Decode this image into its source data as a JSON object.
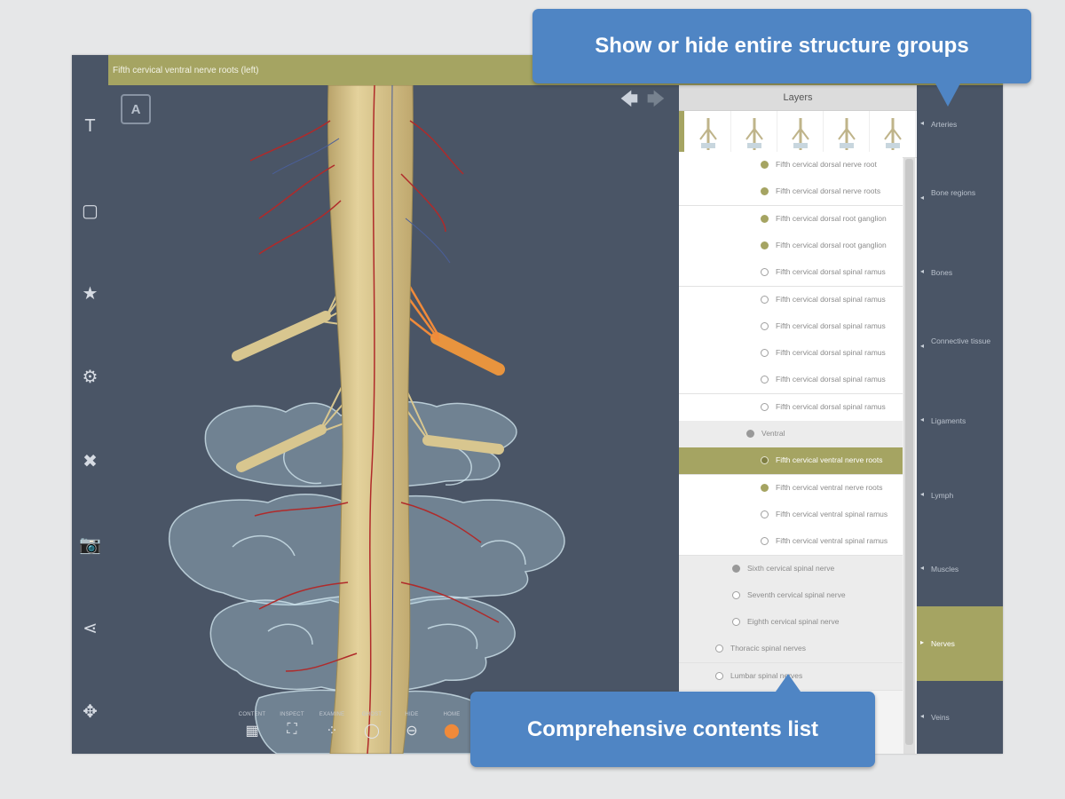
{
  "colors": {
    "accent": "#a5a462",
    "toolbar_bg": "#4a5566",
    "callout_bg": "#4f85c4",
    "artery_red": "#b02a2a",
    "nerve_tan": "#d8c68f",
    "bone_glass": "#b8d6e4",
    "selected_nerve": "#f08a3a"
  },
  "header": {
    "title": "Fifth cervical ventral nerve roots (left)"
  },
  "left_toolbar": [
    {
      "icon": "text-icon",
      "glyph": "T"
    },
    {
      "icon": "square-icon",
      "glyph": "▢"
    },
    {
      "icon": "star-icon",
      "glyph": "★"
    },
    {
      "icon": "gear-icon",
      "glyph": "⚙"
    },
    {
      "icon": "tools-icon",
      "glyph": "✖"
    },
    {
      "icon": "camera-icon",
      "glyph": "📷"
    },
    {
      "icon": "share-icon",
      "glyph": "⋖"
    },
    {
      "icon": "move-icon",
      "glyph": "✥"
    }
  ],
  "viewport": {
    "view_cube_label": "A",
    "back_arrow_glyph": "🡄",
    "forward_arrow_glyph": "🡆",
    "bottom_tools": [
      {
        "label": "CONTENT",
        "icon": "content-icon",
        "glyph": "▦"
      },
      {
        "label": "INSPECT",
        "icon": "inspect-icon",
        "glyph": "⛶"
      },
      {
        "label": "EXAMINE",
        "icon": "examine-icon",
        "glyph": "⁘"
      },
      {
        "label": "GHOST",
        "icon": "ghost-icon",
        "glyph": "◯"
      },
      {
        "label": "HIDE",
        "icon": "hide-icon",
        "glyph": "⊖"
      },
      {
        "label": "HOME",
        "icon": "home-icon",
        "glyph": "⬤"
      }
    ]
  },
  "layers_panel": {
    "header": "Layers",
    "rows": [
      {
        "text": "Fifth cervical dorsal nerve root",
        "marker": "filled",
        "style": "white"
      },
      {
        "text": "Fifth cervical dorsal nerve roots",
        "marker": "filled",
        "style": "white"
      },
      {
        "text": "Fifth cervical dorsal root ganglion",
        "marker": "filled",
        "style": "white"
      },
      {
        "text": "Fifth cervical dorsal root ganglion",
        "marker": "filled",
        "style": "white"
      },
      {
        "text": "Fifth cervical dorsal spinal ramus",
        "marker": "empty",
        "style": "white"
      },
      {
        "text": "Fifth cervical dorsal spinal ramus",
        "marker": "empty",
        "style": "white"
      },
      {
        "text": "Fifth cervical dorsal spinal ramus",
        "marker": "empty",
        "style": "white"
      },
      {
        "text": "Fifth cervical dorsal spinal ramus",
        "marker": "empty",
        "style": "white"
      },
      {
        "text": "Fifth cervical dorsal spinal ramus",
        "marker": "empty",
        "style": "white"
      },
      {
        "text": "Fifth cervical dorsal spinal ramus",
        "marker": "empty",
        "style": "white"
      },
      {
        "text": "Ventral",
        "marker": "grey",
        "style": "grey"
      },
      {
        "text": "Fifth cervical ventral nerve roots",
        "marker": "filled",
        "style": "sel"
      },
      {
        "text": "Fifth cervical ventral nerve roots",
        "marker": "filled",
        "style": "white"
      },
      {
        "text": "Fifth cervical ventral spinal ramus",
        "marker": "empty",
        "style": "white"
      },
      {
        "text": "Fifth cervical ventral spinal ramus",
        "marker": "empty",
        "style": "white"
      },
      {
        "text": "Sixth cervical spinal nerve",
        "marker": "grey",
        "style": "grey"
      },
      {
        "text": "Seventh cervical spinal nerve",
        "marker": "empty",
        "style": "grey"
      },
      {
        "text": "Eighth cervical spinal nerve",
        "marker": "empty",
        "style": "grey"
      },
      {
        "text": "Thoracic spinal nerves",
        "marker": "empty",
        "style": "grey"
      },
      {
        "text": "Lumbar spinal nerves",
        "marker": "empty",
        "style": "grey"
      }
    ]
  },
  "categories": [
    {
      "label": "Arteries",
      "active": false
    },
    {
      "label": "Bone regions",
      "active": false
    },
    {
      "label": "Bones",
      "active": false
    },
    {
      "label": "Connective tissue",
      "active": false
    },
    {
      "label": "Ligaments",
      "active": false
    },
    {
      "label": "Lymph",
      "active": false
    },
    {
      "label": "Muscles",
      "active": false
    },
    {
      "label": "Nerves",
      "active": true
    },
    {
      "label": "Veins",
      "active": false
    }
  ],
  "callouts": {
    "top": "Show or hide entire structure groups",
    "bottom": "Comprehensive contents list"
  }
}
